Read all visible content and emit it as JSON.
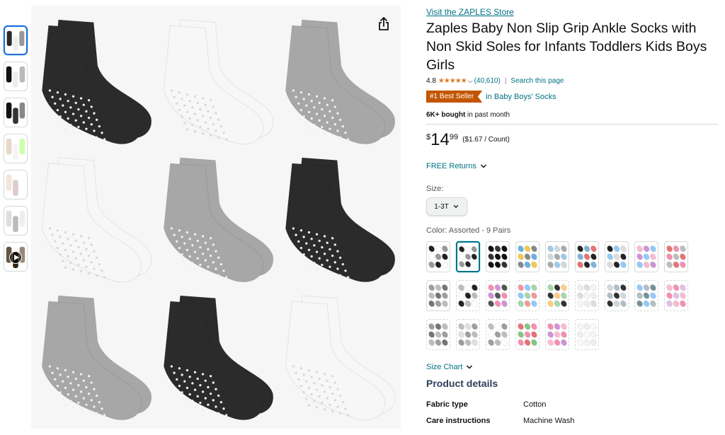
{
  "gallery": {
    "thumbnails": [
      {
        "name": "thumb-socks-grid",
        "selected": true
      },
      {
        "name": "thumb-sock-sole"
      },
      {
        "name": "thumb-sock-package"
      },
      {
        "name": "thumb-baby-lifestyle-1"
      },
      {
        "name": "thumb-baby-lifestyle-2"
      },
      {
        "name": "thumb-feet-closeup"
      },
      {
        "name": "thumb-video",
        "video": true
      }
    ]
  },
  "product": {
    "store_link": "Visit the ZAPLES Store",
    "title": "Zaples Baby Non Slip Grip Ankle Socks with Non Skid Soles for Infants Toddlers Kids Boys Girls",
    "rating": "4.8",
    "stars": "★★★★★",
    "review_count": "(40,610)",
    "search_link": "Search this page",
    "best_seller_badge": "#1 Best Seller",
    "best_seller_category": "in Baby Boys' Socks",
    "bought_bold": "6K+ bought",
    "bought_rest": " in past month",
    "price_symbol": "$",
    "price_whole": "14",
    "price_fraction": "99",
    "price_per_unit": "($1.67 / Count)",
    "returns": "FREE Returns",
    "size_label": "Size:",
    "size_value": "1-3T",
    "color_label": "Color: Assorted - 9 Pairs",
    "size_chart": "Size Chart",
    "product_details_title": "Product details",
    "details": [
      {
        "key": "Fabric type",
        "value": "Cotton"
      },
      {
        "key": "Care instructions",
        "value": "Machine Wash"
      }
    ]
  },
  "swatches": [
    [
      "#222",
      "#fff",
      "#999"
    ],
    [
      "#222",
      "#fff",
      "#999"
    ],
    [
      "#111",
      "#333",
      "#111"
    ],
    [
      "#6ab0de",
      "#f2c94c",
      "#888"
    ],
    [
      "#9ecbe9",
      "#cfd8dc",
      "#aaa"
    ],
    [
      "#222",
      "#7fb3d5",
      "#e57373"
    ],
    [
      "#222",
      "#90caf9",
      "#ddd"
    ],
    [
      "#f8bbd0",
      "#ce93d8",
      "#90caf9"
    ],
    [
      "#e57373",
      "#f48fb1",
      "#bdbdbd"
    ],
    [
      "#9e9e9e",
      "#bdbdbd",
      "#757575"
    ],
    [
      "#bbb",
      "#fff",
      "#222"
    ],
    [
      "#f48fb1",
      "#ce93d8",
      "#555"
    ],
    [
      "#ef9a9a",
      "#90caf9",
      "#a5d6a7"
    ],
    [
      "#a5d6a7",
      "#333",
      "#ffcc80"
    ],
    [
      "#eee",
      "#ddd",
      "#f5f5f5"
    ],
    [
      "#cfd8dc",
      "#b0bec5",
      "#333"
    ],
    [
      "#90caf9",
      "#b0bec5",
      "#78909c"
    ],
    [
      "#f8bbd0",
      "#f48fb1",
      "#e1bee7"
    ],
    [
      "#9e9e9e",
      "#757575",
      "#bdbdbd"
    ],
    [
      "#bdbdbd",
      "#e0e0e0",
      "#9e9e9e"
    ],
    [
      "#bdbdbd",
      "#fff",
      "#9e9e9e"
    ],
    [
      "#e57373",
      "#81c784",
      "#f48fb1"
    ],
    [
      "#f48fb1",
      "#ce93d8",
      "#f8bbd0"
    ],
    [
      "#f5f5f5",
      "#eeeeee",
      "#fafafa"
    ]
  ],
  "colors": {
    "link": "#007185",
    "badge": "#c45500",
    "star": "#de7921"
  }
}
